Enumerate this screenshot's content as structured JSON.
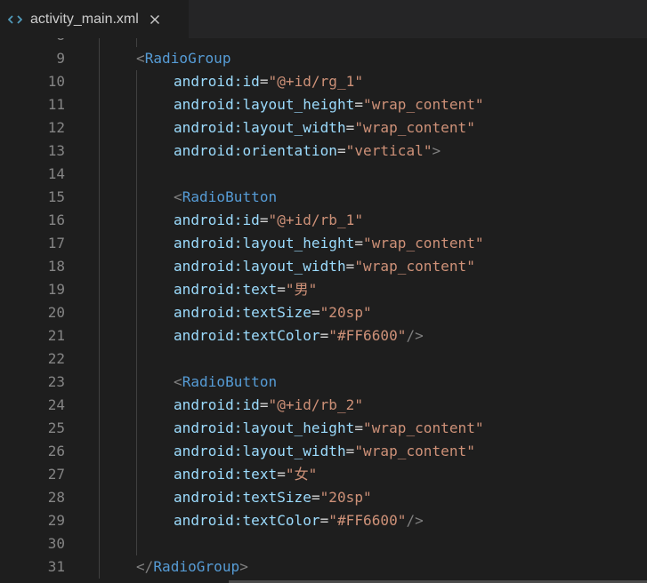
{
  "tab": {
    "filename": "activity_main.xml",
    "icon": "code-brackets-icon",
    "close_icon": "close-icon"
  },
  "colors": {
    "background": "#1e1e1e",
    "tag": "#569cd6",
    "attribute": "#9cdcfe",
    "string": "#ce9178",
    "punctuation": "#808080",
    "line_number": "#858585"
  },
  "lines": [
    {
      "number": "8",
      "indent": 2,
      "tokens": []
    },
    {
      "number": "9",
      "indent": 1,
      "tokens": [
        [
          "tk-punct",
          "<"
        ],
        [
          "tk-tag",
          "RadioGroup"
        ]
      ]
    },
    {
      "number": "10",
      "indent": 2,
      "tokens": [
        [
          "tk-attr",
          "android:id"
        ],
        [
          "tk-eq",
          "="
        ],
        [
          "tk-str",
          "\"@+id/rg_1\""
        ]
      ]
    },
    {
      "number": "11",
      "indent": 2,
      "tokens": [
        [
          "tk-attr",
          "android:layout_height"
        ],
        [
          "tk-eq",
          "="
        ],
        [
          "tk-str",
          "\"wrap_content\""
        ]
      ]
    },
    {
      "number": "12",
      "indent": 2,
      "tokens": [
        [
          "tk-attr",
          "android:layout_width"
        ],
        [
          "tk-eq",
          "="
        ],
        [
          "tk-str",
          "\"wrap_content\""
        ]
      ]
    },
    {
      "number": "13",
      "indent": 2,
      "tokens": [
        [
          "tk-attr",
          "android:orientation"
        ],
        [
          "tk-eq",
          "="
        ],
        [
          "tk-str",
          "\"vertical\""
        ],
        [
          "tk-punct",
          ">"
        ]
      ]
    },
    {
      "number": "14",
      "indent": 2,
      "tokens": []
    },
    {
      "number": "15",
      "indent": 2,
      "tokens": [
        [
          "tk-punct",
          "<"
        ],
        [
          "tk-tag",
          "RadioButton"
        ]
      ]
    },
    {
      "number": "16",
      "indent": 2,
      "tokens": [
        [
          "tk-attr",
          "android:id"
        ],
        [
          "tk-eq",
          "="
        ],
        [
          "tk-str",
          "\"@+id/rb_1\""
        ]
      ]
    },
    {
      "number": "17",
      "indent": 2,
      "tokens": [
        [
          "tk-attr",
          "android:layout_height"
        ],
        [
          "tk-eq",
          "="
        ],
        [
          "tk-str",
          "\"wrap_content\""
        ]
      ]
    },
    {
      "number": "18",
      "indent": 2,
      "tokens": [
        [
          "tk-attr",
          "android:layout_width"
        ],
        [
          "tk-eq",
          "="
        ],
        [
          "tk-str",
          "\"wrap_content\""
        ]
      ]
    },
    {
      "number": "19",
      "indent": 2,
      "tokens": [
        [
          "tk-attr",
          "android:text"
        ],
        [
          "tk-eq",
          "="
        ],
        [
          "tk-str",
          "\"男\""
        ]
      ]
    },
    {
      "number": "20",
      "indent": 2,
      "tokens": [
        [
          "tk-attr",
          "android:textSize"
        ],
        [
          "tk-eq",
          "="
        ],
        [
          "tk-str",
          "\"20sp\""
        ]
      ]
    },
    {
      "number": "21",
      "indent": 2,
      "tokens": [
        [
          "tk-attr",
          "android:textColor"
        ],
        [
          "tk-eq",
          "="
        ],
        [
          "tk-str",
          "\"#FF6600\""
        ],
        [
          "tk-punct",
          "/>"
        ]
      ]
    },
    {
      "number": "22",
      "indent": 2,
      "tokens": []
    },
    {
      "number": "23",
      "indent": 2,
      "tokens": [
        [
          "tk-punct",
          "<"
        ],
        [
          "tk-tag",
          "RadioButton"
        ]
      ]
    },
    {
      "number": "24",
      "indent": 2,
      "tokens": [
        [
          "tk-attr",
          "android:id"
        ],
        [
          "tk-eq",
          "="
        ],
        [
          "tk-str",
          "\"@+id/rb_2\""
        ]
      ]
    },
    {
      "number": "25",
      "indent": 2,
      "tokens": [
        [
          "tk-attr",
          "android:layout_height"
        ],
        [
          "tk-eq",
          "="
        ],
        [
          "tk-str",
          "\"wrap_content\""
        ]
      ]
    },
    {
      "number": "26",
      "indent": 2,
      "tokens": [
        [
          "tk-attr",
          "android:layout_width"
        ],
        [
          "tk-eq",
          "="
        ],
        [
          "tk-str",
          "\"wrap_content\""
        ]
      ]
    },
    {
      "number": "27",
      "indent": 2,
      "tokens": [
        [
          "tk-attr",
          "android:text"
        ],
        [
          "tk-eq",
          "="
        ],
        [
          "tk-str",
          "\"女\""
        ]
      ]
    },
    {
      "number": "28",
      "indent": 2,
      "tokens": [
        [
          "tk-attr",
          "android:textSize"
        ],
        [
          "tk-eq",
          "="
        ],
        [
          "tk-str",
          "\"20sp\""
        ]
      ]
    },
    {
      "number": "29",
      "indent": 2,
      "tokens": [
        [
          "tk-attr",
          "android:textColor"
        ],
        [
          "tk-eq",
          "="
        ],
        [
          "tk-str",
          "\"#FF6600\""
        ],
        [
          "tk-punct",
          "/>"
        ]
      ]
    },
    {
      "number": "30",
      "indent": 2,
      "tokens": []
    },
    {
      "number": "31",
      "indent": 1,
      "tokens": [
        [
          "tk-punct",
          "</"
        ],
        [
          "tk-tag",
          "RadioGroup"
        ],
        [
          "tk-punct",
          ">"
        ]
      ]
    }
  ]
}
